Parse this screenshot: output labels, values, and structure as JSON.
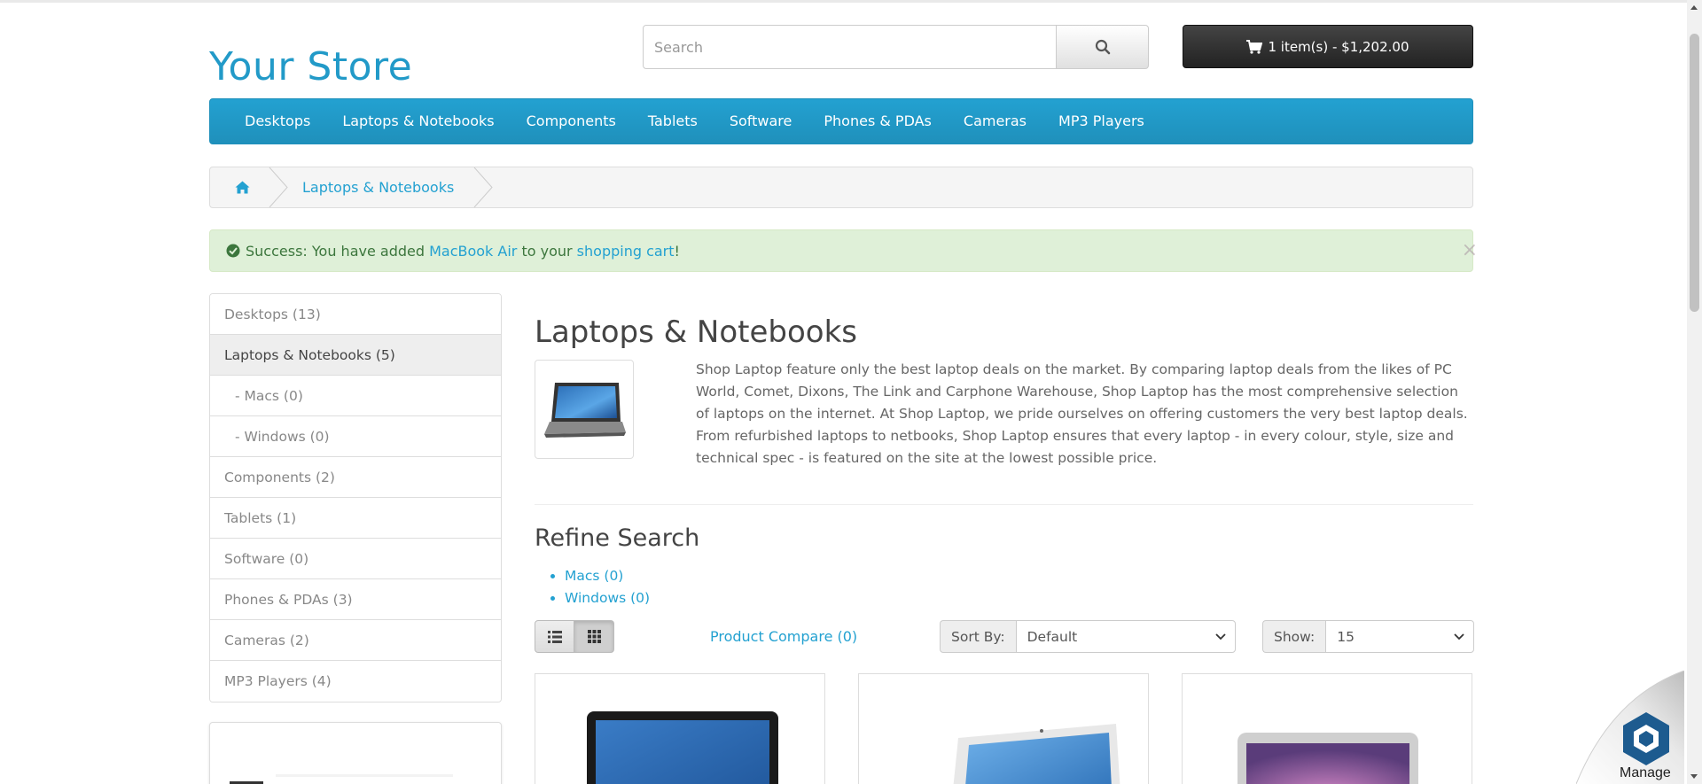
{
  "store": {
    "logo": "Your Store"
  },
  "search": {
    "placeholder": "Search"
  },
  "cart": {
    "label": "1 item(s) - $1,202.00"
  },
  "menu": [
    "Desktops",
    "Laptops & Notebooks",
    "Components",
    "Tablets",
    "Software",
    "Phones & PDAs",
    "Cameras",
    "MP3 Players"
  ],
  "breadcrumb": {
    "current": "Laptops & Notebooks"
  },
  "alert": {
    "prefix": "Success: You have added ",
    "product": "MacBook Air",
    "middle": " to your ",
    "cart_link": "shopping cart",
    "suffix": "!",
    "close": "×"
  },
  "categories": [
    {
      "label": "Desktops (13)"
    },
    {
      "label": "Laptops & Notebooks (5)"
    },
    {
      "label": "- Macs (0)"
    },
    {
      "label": "- Windows (0)"
    },
    {
      "label": "Components (2)"
    },
    {
      "label": "Tablets (1)"
    },
    {
      "label": "Software (0)"
    },
    {
      "label": "Phones & PDAs (3)"
    },
    {
      "label": "Cameras (2)"
    },
    {
      "label": "MP3 Players (4)"
    }
  ],
  "content": {
    "title": "Laptops & Notebooks",
    "description": "Shop Laptop feature only the best laptop deals on the market. By comparing laptop deals from the likes of PC World, Comet, Dixons, The Link and Carphone Warehouse, Shop Laptop has the most comprehensive selection of laptops on the internet. At Shop Laptop, we pride ourselves on offering customers the very best laptop deals. From refurbished laptops to netbooks, Shop Laptop ensures that every laptop - in every colour, style, size and technical spec - is featured on the site at the lowest possible price.",
    "refine_title": "Refine Search",
    "refine": [
      "Macs (0)",
      "Windows (0)"
    ]
  },
  "toolbar": {
    "compare": "Product Compare (0)",
    "sort_label": "Sort By:",
    "sort_value": "Default",
    "show_label": "Show:",
    "show_value": "15"
  },
  "widget": {
    "label": "Manage"
  },
  "colors": {
    "accent": "#229ac8",
    "alert_bg": "#dff0d8",
    "cart_bg": "#2b2b2b"
  }
}
